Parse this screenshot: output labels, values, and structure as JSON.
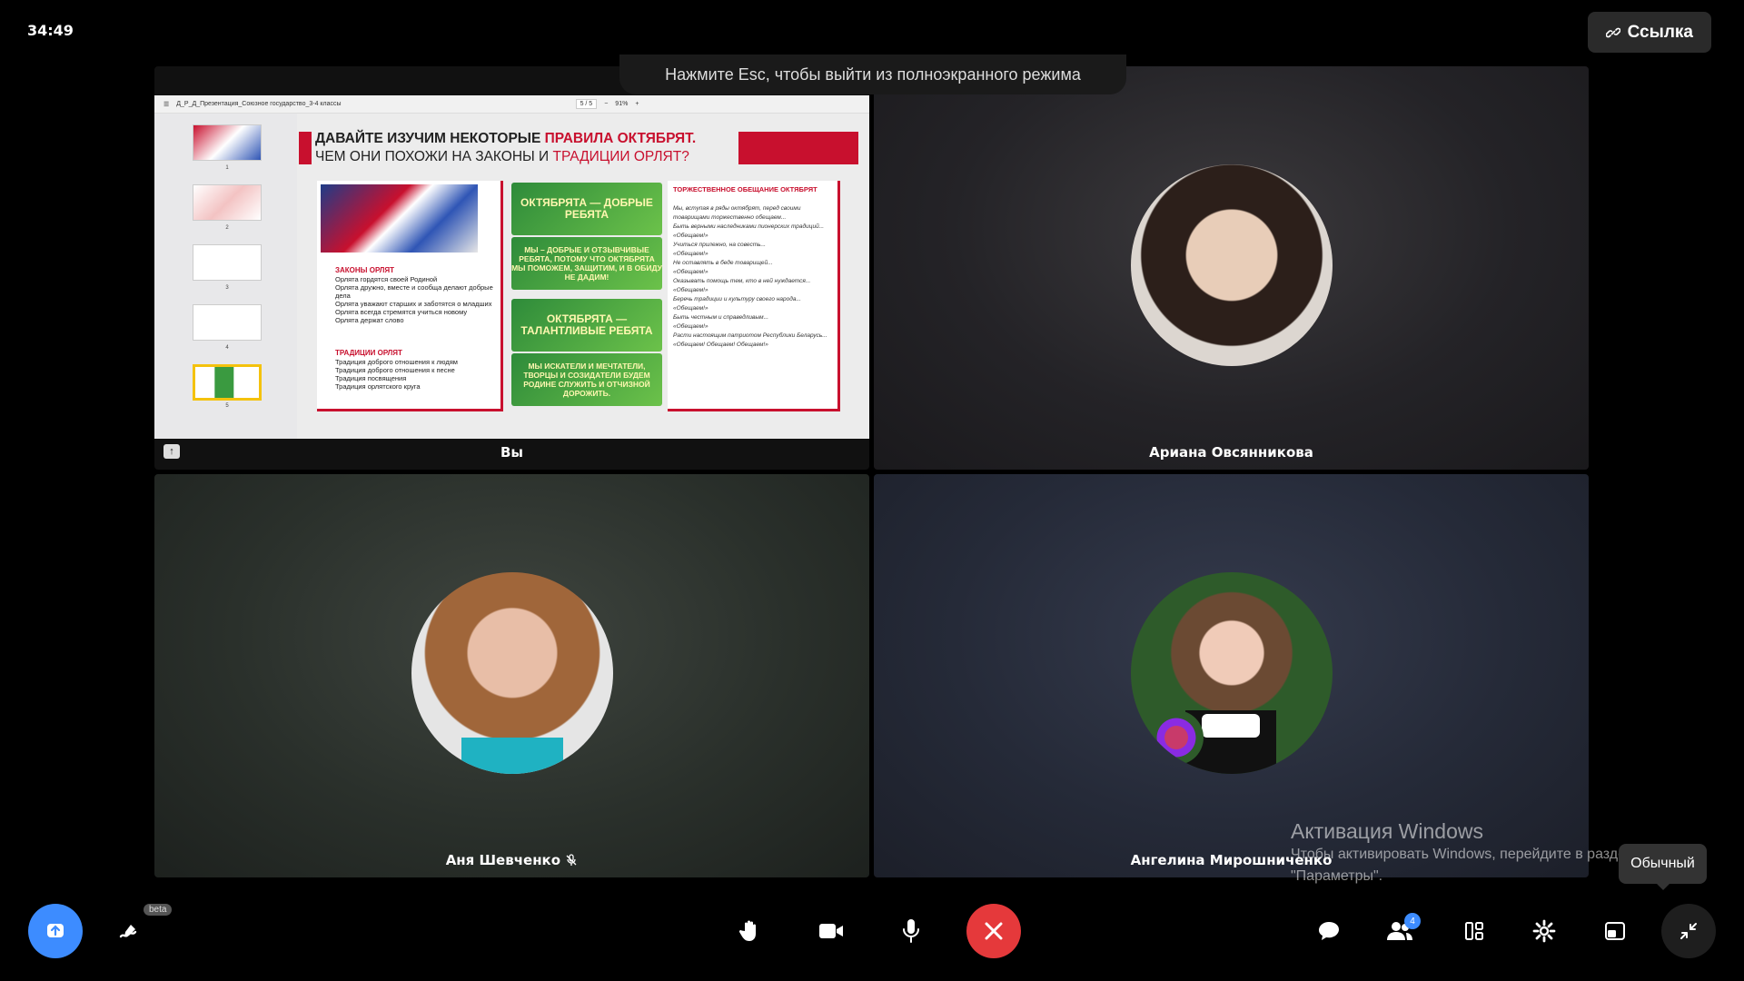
{
  "header": {
    "timer": "34:49",
    "link_label": "Ссылка",
    "esc_hint": "Нажмите Esc, чтобы выйти из полноэкранного режима"
  },
  "tiles": [
    {
      "name": "Вы"
    },
    {
      "name": "Ариана Овсянникова"
    },
    {
      "name": "Аня Шевченко"
    },
    {
      "name": "Ангелина Мирошниченко"
    }
  ],
  "pdf": {
    "filename": "Д_Р_Д_Презентация_Союзное государство_3-4 классы",
    "page": "5 / 5",
    "zoom": "91%",
    "thumb_nums": [
      "1",
      "2",
      "3",
      "4",
      "5"
    ]
  },
  "slide": {
    "title_a": "ДАВАЙТЕ ИЗУЧИМ НЕКОТОРЫЕ ",
    "title_b": "ПРАВИЛА ОКТЯБРЯТ.",
    "title_c": "ЧЕМ ОНИ ПОХОЖИ НА ЗАКОНЫ И ",
    "title_d": "ТРАДИЦИИ ОРЛЯТ?",
    "laws_heading": "ЗАКОНЫ ОРЛЯТ",
    "laws": "Орлята гордятся своей Родиной\nОрлята дружно, вместе и сообща делают добрые дела\nОрлята уважают старших и заботятся о младших\nОрлята всегда стремятся учиться новому\nОрлята держат слово",
    "trad_heading": "ТРАДИЦИИ ОРЛЯТ",
    "trads": "Традиция доброго отношения к людям\nТрадиция доброго отношения к песне\nТрадиция посвящения\nТрадиция орлятского круга",
    "green1": "ОКТЯБРЯТА — ДОБРЫЕ РЕБЯТА",
    "green2": "МЫ – ДОБРЫЕ И ОТЗЫВЧИВЫЕ РЕБЯТА, ПОТОМУ ЧТО ОКТЯБРЯТА МЫ ПОМОЖЕМ, ЗАЩИТИМ, И В ОБИДУ НЕ ДАДИМ!",
    "green3": "ОКТЯБРЯТА — ТАЛАНТЛИВЫЕ РЕБЯТА",
    "green4": "МЫ ИСКАТЕЛИ И МЕЧТАТЕЛИ, ТВОРЦЫ И СОЗИДАТЕЛИ БУДЕМ РОДИНЕ СЛУЖИТЬ И ОТЧИЗНОЙ ДОРОЖИТЬ.",
    "oath_heading": "ТОРЖЕСТВЕННОЕ ОБЕЩАНИЕ ОКТЯБРЯТ",
    "oath": "Мы, вступая в ряды октябрят, перед своими товарищами торжественно обещаем...\nБыть верными наследниками пионерских традиций...\n«Обещаем!»\nУчиться прилежно, на совесть...\n«Обещаем!»\nНе оставлять в беде товарищей...\n«Обещаем!»\nОказывать помощь тем, кто в ней нуждается...\n«Обещаем!»\nБеречь традиции и культуру своего народа...\n«Обещаем!»\nБыть честным и справедливым...\n«Обещаем!»\nРасти настоящим патриотом Республики Беларусь...\n«Обещаем! Обещаем! Обещаем!»"
  },
  "watermark": {
    "line1": "Активация Windows",
    "line2": "Чтобы активировать Windows, перейдите в раздел",
    "line3": "\"Параметры\"."
  },
  "tooltip": "Обычный",
  "toolbar": {
    "beta": "beta",
    "participants_count": "4"
  },
  "colors": {
    "accent": "#3d8cff",
    "end_call": "#e5393b",
    "slide_red": "#c8102e"
  }
}
